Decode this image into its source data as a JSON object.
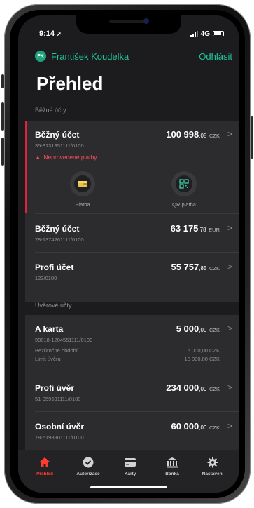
{
  "status_bar": {
    "time": "9:14",
    "network": "4G"
  },
  "header": {
    "user_initials": "FK",
    "user_name": "František Koudelka",
    "logout_label": "Odhlásit"
  },
  "page_title": "Přehled",
  "current_accounts": {
    "section_label": "Běžné účty",
    "accounts": [
      {
        "name": "Běžný účet",
        "number": "35-3131351111/0100",
        "amount_main": "100 998",
        "amount_dec": ",08",
        "currency": "CZK",
        "warning": "Neprovedené platby"
      },
      {
        "name": "Běžný účet",
        "number": "78-1374261111/0100",
        "amount_main": "63 175",
        "amount_dec": ",78",
        "currency": "EUR"
      },
      {
        "name": "Profi účet",
        "number": "123/0100",
        "amount_main": "55 757",
        "amount_dec": ",85",
        "currency": "CZK"
      }
    ],
    "actions": [
      {
        "label": "Platba",
        "icon": "wallet-icon"
      },
      {
        "label": "QR platba",
        "icon": "qr-code-icon"
      }
    ]
  },
  "credit_accounts": {
    "section_label": "Úvěrové účty",
    "accounts": [
      {
        "name": "A karta",
        "number": "90018-1204551111/0100",
        "amount_main": "5 000",
        "amount_dec": ",00",
        "currency": "CZK",
        "details": [
          {
            "label": "Bezúročné období",
            "value": "5 000,00 CZK"
          },
          {
            "label": "Limit úvěru",
            "value": "10 000,00 CZK"
          }
        ]
      },
      {
        "name": "Profi úvěr",
        "number": "51-959591111/0100",
        "amount_main": "234 000",
        "amount_dec": ",00",
        "currency": "CZK"
      },
      {
        "name": "Osobní úvěr",
        "number": "78-5193901111/0100",
        "amount_main": "60 000",
        "amount_dec": ",00",
        "currency": "CZK"
      }
    ]
  },
  "tabbar": {
    "tabs": [
      {
        "label": "Přehled",
        "icon": "home-icon",
        "active": true
      },
      {
        "label": "Autorizace",
        "icon": "check-circle-icon"
      },
      {
        "label": "Karty",
        "icon": "card-icon"
      },
      {
        "label": "Banka",
        "icon": "bank-icon"
      },
      {
        "label": "Nastavení",
        "icon": "gear-icon"
      }
    ]
  },
  "colors": {
    "accent": "#1fc29a",
    "warning": "#ff4b5c",
    "active_tab": "#ff3b30",
    "background": "#1c1c1e",
    "card": "#2c2c2e"
  }
}
